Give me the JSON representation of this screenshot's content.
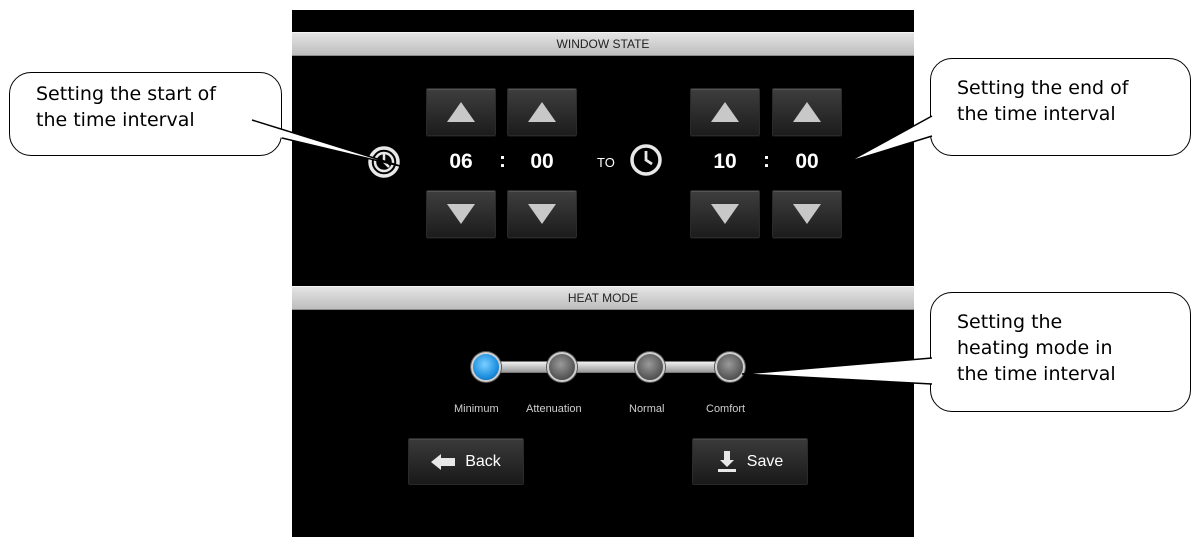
{
  "window_state": {
    "title": "WINDOW STATE",
    "start": {
      "hours": "06",
      "minutes": "00"
    },
    "separator": ":",
    "to_label": "TO",
    "end": {
      "hours": "10",
      "minutes": "00"
    }
  },
  "heat_mode": {
    "title": "HEAT MODE",
    "options": [
      "Minimum",
      "Attenuation",
      "Normal",
      "Comfort"
    ],
    "selected": "Minimum",
    "accent_color": "#1e8fe0"
  },
  "actions": {
    "back_label": "Back",
    "save_label": "Save"
  },
  "callouts": {
    "start_line1": "Setting the start of",
    "start_line2": "the time interval",
    "end_line1": "Setting the end of",
    "end_line2": "the time interval",
    "heat_line1": "Setting the",
    "heat_line2": "heating mode in",
    "heat_line3": "the time interval"
  },
  "icons": {
    "spin_up": "triangle-up-icon",
    "spin_down": "triangle-down-icon",
    "clock": "clock-icon",
    "back": "arrow-left-icon",
    "save": "download-icon"
  }
}
